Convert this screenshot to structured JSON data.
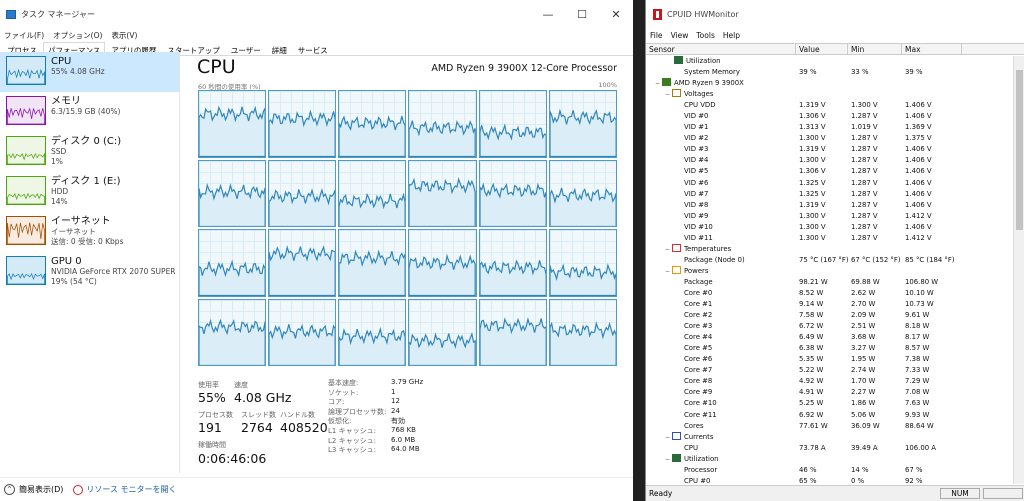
{
  "taskmgr": {
    "title": "タスク マネージャー",
    "menu": [
      "ファイル(F)",
      "オプション(O)",
      "表示(V)"
    ],
    "tabs": [
      "プロセス",
      "パフォーマンス",
      "アプリの履歴",
      "スタートアップ",
      "ユーザー",
      "詳細",
      "サービス"
    ],
    "active_tab": 1,
    "win_buttons": [
      "—",
      "☐",
      "✕"
    ],
    "sidebar": [
      {
        "name": "CPU",
        "l1": "55% 4.08 GHz",
        "l2": "",
        "color": "#117dbb",
        "fill": "#d4eaf7",
        "sel": true
      },
      {
        "name": "メモリ",
        "l1": "6.3/15.9 GB (40%)",
        "l2": "",
        "color": "#8b12ae",
        "fill": "#f1e4f6",
        "sel": false
      },
      {
        "name": "ディスク 0 (C:)",
        "l1": "SSD",
        "l2": "1%",
        "color": "#4da60c",
        "fill": "#eef7e6",
        "sel": false
      },
      {
        "name": "ディスク 1 (E:)",
        "l1": "HDD",
        "l2": "14%",
        "color": "#4da60c",
        "fill": "#eef7e6",
        "sel": false
      },
      {
        "name": "イーサネット",
        "l1": "イーサネット",
        "l2": "送信: 0 受信: 0 Kbps",
        "color": "#a74f01",
        "fill": "#f8ece2",
        "sel": false
      },
      {
        "name": "GPU 0",
        "l1": "NVIDIA GeForce RTX 2070 SUPER",
        "l2": "19% (54 °C)",
        "color": "#117dbb",
        "fill": "#d4eaf7",
        "sel": false
      }
    ],
    "main_title": "CPU",
    "processor": "AMD Ryzen 9 3900X 12-Core Processor",
    "axis_left": "60 秒間の使用率 (%)",
    "axis_right": "100%",
    "stats": {
      "usage_label": "使用率",
      "usage": "55%",
      "speed_label": "速度",
      "speed": "4.08 GHz",
      "proc_label": "プロセス数",
      "proc": "191",
      "thread_label": "スレッド数",
      "thread": "2764",
      "handle_label": "ハンドル数",
      "handle": "408520",
      "uptime_label": "稼働時間",
      "uptime": "0:06:46:06"
    },
    "kv": [
      [
        "基本速度:",
        "3.79 GHz"
      ],
      [
        "ソケット:",
        "1"
      ],
      [
        "コア:",
        "12"
      ],
      [
        "論理プロセッサ数:",
        "24"
      ],
      [
        "仮想化:",
        "有効"
      ],
      [
        "L1 キャッシュ:",
        "768 KB"
      ],
      [
        "L2 キャッシュ:",
        "6.0 MB"
      ],
      [
        "L3 キャッシュ:",
        "64.0 MB"
      ]
    ],
    "footer_less": "簡易表示(D)",
    "footer_monitor": "リソース モニターを開く"
  },
  "hwmon": {
    "title": "CPUID HWMonitor",
    "menu": [
      "File",
      "View",
      "Tools",
      "Help"
    ],
    "columns": [
      "Sensor",
      "Value",
      "Min",
      "Max"
    ],
    "status": "Ready",
    "num": "NUM",
    "rows": [
      {
        "d": 2,
        "t": "",
        "ic": "g",
        "n": "Utilization",
        "v": "",
        "mi": "",
        "ma": ""
      },
      {
        "d": 3,
        "t": "",
        "ic": "",
        "n": "System Memory",
        "v": "39 %",
        "mi": "33 %",
        "ma": "39 %"
      },
      {
        "d": 0,
        "t": "−",
        "ic": "c",
        "n": "AMD Ryzen 9 3900X",
        "v": "",
        "mi": "",
        "ma": ""
      },
      {
        "d": 1,
        "t": "−",
        "ic": "v",
        "n": "Voltages",
        "v": "",
        "mi": "",
        "ma": ""
      },
      {
        "d": 3,
        "t": "",
        "ic": "",
        "n": "CPU VDD",
        "v": "1.319 V",
        "mi": "1.300 V",
        "ma": "1.406 V"
      },
      {
        "d": 3,
        "t": "",
        "ic": "",
        "n": "VID #0",
        "v": "1.306 V",
        "mi": "1.287 V",
        "ma": "1.406 V"
      },
      {
        "d": 3,
        "t": "",
        "ic": "",
        "n": "VID #1",
        "v": "1.313 V",
        "mi": "1.019 V",
        "ma": "1.369 V"
      },
      {
        "d": 3,
        "t": "",
        "ic": "",
        "n": "VID #2",
        "v": "1.300 V",
        "mi": "1.287 V",
        "ma": "1.375 V"
      },
      {
        "d": 3,
        "t": "",
        "ic": "",
        "n": "VID #3",
        "v": "1.319 V",
        "mi": "1.287 V",
        "ma": "1.406 V"
      },
      {
        "d": 3,
        "t": "",
        "ic": "",
        "n": "VID #4",
        "v": "1.300 V",
        "mi": "1.287 V",
        "ma": "1.406 V"
      },
      {
        "d": 3,
        "t": "",
        "ic": "",
        "n": "VID #5",
        "v": "1.306 V",
        "mi": "1.287 V",
        "ma": "1.406 V"
      },
      {
        "d": 3,
        "t": "",
        "ic": "",
        "n": "VID #6",
        "v": "1.325 V",
        "mi": "1.287 V",
        "ma": "1.406 V"
      },
      {
        "d": 3,
        "t": "",
        "ic": "",
        "n": "VID #7",
        "v": "1.325 V",
        "mi": "1.287 V",
        "ma": "1.406 V"
      },
      {
        "d": 3,
        "t": "",
        "ic": "",
        "n": "VID #8",
        "v": "1.319 V",
        "mi": "1.287 V",
        "ma": "1.406 V"
      },
      {
        "d": 3,
        "t": "",
        "ic": "",
        "n": "VID #9",
        "v": "1.300 V",
        "mi": "1.287 V",
        "ma": "1.412 V"
      },
      {
        "d": 3,
        "t": "",
        "ic": "",
        "n": "VID #10",
        "v": "1.300 V",
        "mi": "1.287 V",
        "ma": "1.406 V"
      },
      {
        "d": 3,
        "t": "",
        "ic": "",
        "n": "VID #11",
        "v": "1.300 V",
        "mi": "1.287 V",
        "ma": "1.412 V"
      },
      {
        "d": 1,
        "t": "−",
        "ic": "t",
        "n": "Temperatures",
        "v": "",
        "mi": "",
        "ma": ""
      },
      {
        "d": 3,
        "t": "",
        "ic": "",
        "n": "Package (Node 0)",
        "v": "75 °C  (167 °F)",
        "mi": "67 °C  (152 °F)",
        "ma": "85 °C  (184 °F)"
      },
      {
        "d": 1,
        "t": "−",
        "ic": "p",
        "n": "Powers",
        "v": "",
        "mi": "",
        "ma": ""
      },
      {
        "d": 3,
        "t": "",
        "ic": "",
        "n": "Package",
        "v": "98.21 W",
        "mi": "69.88 W",
        "ma": "106.80 W"
      },
      {
        "d": 3,
        "t": "",
        "ic": "",
        "n": "Core #0",
        "v": "8.52 W",
        "mi": "2.62 W",
        "ma": "10.10 W"
      },
      {
        "d": 3,
        "t": "",
        "ic": "",
        "n": "Core #1",
        "v": "9.14 W",
        "mi": "2.70 W",
        "ma": "10.73 W"
      },
      {
        "d": 3,
        "t": "",
        "ic": "",
        "n": "Core #2",
        "v": "7.58 W",
        "mi": "2.09 W",
        "ma": "9.61 W"
      },
      {
        "d": 3,
        "t": "",
        "ic": "",
        "n": "Core #3",
        "v": "6.72 W",
        "mi": "2.51 W",
        "ma": "8.18 W"
      },
      {
        "d": 3,
        "t": "",
        "ic": "",
        "n": "Core #4",
        "v": "6.49 W",
        "mi": "3.68 W",
        "ma": "8.17 W"
      },
      {
        "d": 3,
        "t": "",
        "ic": "",
        "n": "Core #5",
        "v": "6.38 W",
        "mi": "3.27 W",
        "ma": "8.57 W"
      },
      {
        "d": 3,
        "t": "",
        "ic": "",
        "n": "Core #6",
        "v": "5.35 W",
        "mi": "1.95 W",
        "ma": "7.38 W"
      },
      {
        "d": 3,
        "t": "",
        "ic": "",
        "n": "Core #7",
        "v": "5.22 W",
        "mi": "2.74 W",
        "ma": "7.33 W"
      },
      {
        "d": 3,
        "t": "",
        "ic": "",
        "n": "Core #8",
        "v": "4.92 W",
        "mi": "1.70 W",
        "ma": "7.29 W"
      },
      {
        "d": 3,
        "t": "",
        "ic": "",
        "n": "Core #9",
        "v": "4.91 W",
        "mi": "2.27 W",
        "ma": "7.08 W"
      },
      {
        "d": 3,
        "t": "",
        "ic": "",
        "n": "Core #10",
        "v": "5.25 W",
        "mi": "1.86 W",
        "ma": "7.63 W"
      },
      {
        "d": 3,
        "t": "",
        "ic": "",
        "n": "Core #11",
        "v": "6.92 W",
        "mi": "5.06 W",
        "ma": "9.93 W"
      },
      {
        "d": 3,
        "t": "",
        "ic": "",
        "n": "Cores",
        "v": "77.61 W",
        "mi": "36.09 W",
        "ma": "88.64 W"
      },
      {
        "d": 1,
        "t": "−",
        "ic": "a",
        "n": "Currents",
        "v": "",
        "mi": "",
        "ma": ""
      },
      {
        "d": 3,
        "t": "",
        "ic": "",
        "n": "CPU",
        "v": "73.78 A",
        "mi": "39.49 A",
        "ma": "106.00 A"
      },
      {
        "d": 1,
        "t": "−",
        "ic": "g",
        "n": "Utilization",
        "v": "",
        "mi": "",
        "ma": ""
      },
      {
        "d": 3,
        "t": "",
        "ic": "",
        "n": "Processor",
        "v": "46 %",
        "mi": "14 %",
        "ma": "67 %"
      },
      {
        "d": 3,
        "t": "",
        "ic": "",
        "n": "CPU #0",
        "v": "65 %",
        "mi": "0 %",
        "ma": "92 %"
      }
    ]
  }
}
